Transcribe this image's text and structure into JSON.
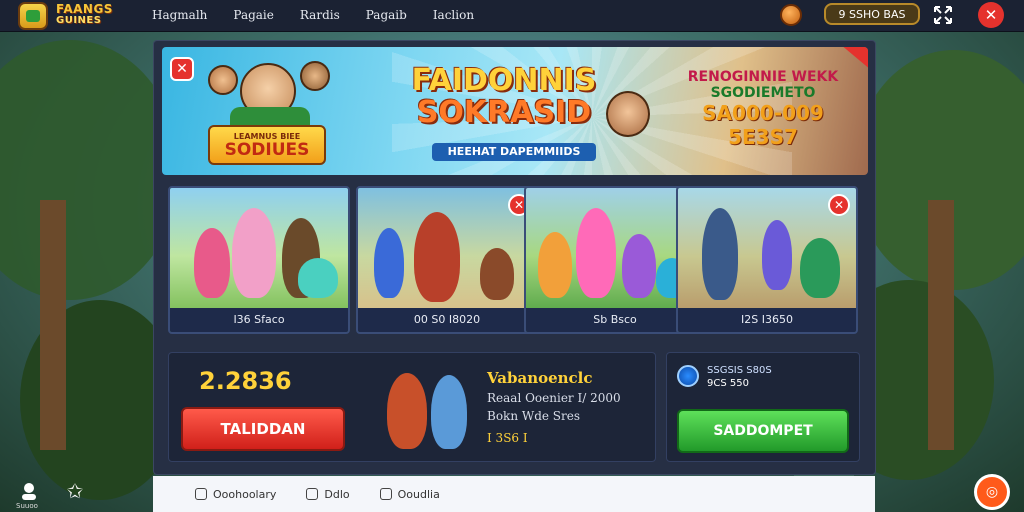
{
  "logo": {
    "line1": "FAANGS",
    "line2": "GUINES"
  },
  "nav": [
    "Hagmalh",
    "Pagaie",
    "Rardis",
    "Pagaib",
    "Iaclion"
  ],
  "balance": {
    "value": "9 SSHO BAS"
  },
  "hero": {
    "ribbon_top": "LEAMNUS BIEE",
    "ribbon_main": "SODIUES",
    "title_line1": "FAIDONNIS",
    "title_line2": "SOKRASID",
    "subtitle": "HEEHAT DAPEMMIIDS",
    "promo_line1": "RENOGINNIE WEKK",
    "promo_line2": "SGODIEMETO",
    "promo_line3": "SA000-009 5E3S7"
  },
  "cards": [
    {
      "label": "I36 Sfaco",
      "closable": false
    },
    {
      "label": "00 S0 I8020",
      "closable": true
    },
    {
      "label": "Sb Bsco",
      "closable": true
    },
    {
      "label": "I2S I3650",
      "closable": true
    }
  ],
  "stake": {
    "amount": "2.2836",
    "button": "TALIDDAN"
  },
  "info": {
    "title": "Vabanoenclc",
    "line1": "Reaal Ooenier I/ 2000",
    "line2": "Bokn Wde Sres",
    "line3": "I 3S6 I"
  },
  "status": {
    "line1": "SSGSIS S80S",
    "line2": "9CS 550"
  },
  "action_button": "SADDOMPET",
  "footer": [
    "Ooohoolary",
    "Ddlo",
    "Ooudlia"
  ],
  "side_label": "Suuoo"
}
